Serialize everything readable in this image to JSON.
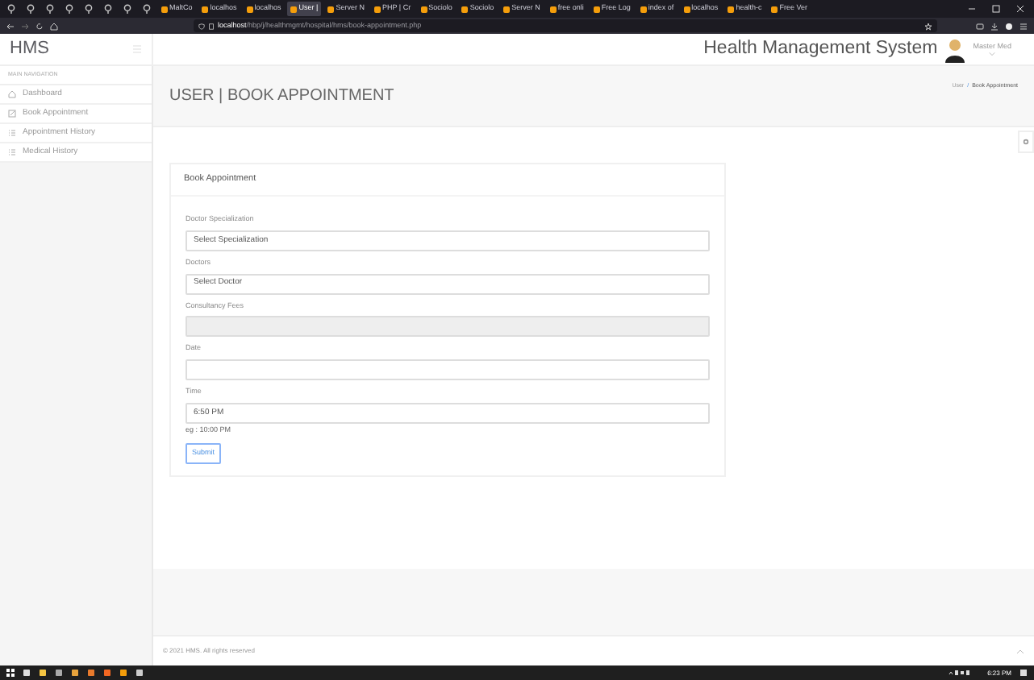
{
  "browser": {
    "tabs": [
      {
        "label": "MaltCo",
        "selected": false
      },
      {
        "label": "localhos",
        "selected": false
      },
      {
        "label": "localhos",
        "selected": false
      },
      {
        "label": "User |",
        "selected": true
      },
      {
        "label": "Server N",
        "selected": false
      },
      {
        "label": "PHP | Cr",
        "selected": false
      },
      {
        "label": "Sociolo",
        "selected": false
      },
      {
        "label": "Sociolo",
        "selected": false
      },
      {
        "label": "Server N",
        "selected": false
      },
      {
        "label": "free onli",
        "selected": false
      },
      {
        "label": "Free Log",
        "selected": false
      },
      {
        "label": "index of",
        "selected": false
      },
      {
        "label": "localhos",
        "selected": false
      },
      {
        "label": "health-c",
        "selected": false
      },
      {
        "label": "Free Ver",
        "selected": false
      }
    ],
    "url_host": "localhost",
    "url_path": "/hbp/j/healthmgmt/hospital/hms/book-appointment.php"
  },
  "header": {
    "logo": "HMS",
    "title": "Health Management System",
    "user": "Master Med"
  },
  "sidebar": {
    "heading": "MAIN NAVIGATION",
    "items": [
      {
        "label": "Dashboard",
        "kind": "home"
      },
      {
        "label": "Book Appointment",
        "kind": "edit"
      },
      {
        "label": "Appointment History",
        "kind": "list"
      },
      {
        "label": "Medical History",
        "kind": "list"
      }
    ]
  },
  "page": {
    "title": "USER | BOOK APPOINTMENT",
    "breadcrumb": [
      "User",
      "Book Appointment"
    ],
    "breadcrumb_separator": "/"
  },
  "form": {
    "title": "Book Appointment",
    "fields": [
      {
        "label": "Doctor Specialization",
        "value": "Select Specialization",
        "disabled": false
      },
      {
        "label": "Doctors",
        "value": "Select Doctor",
        "disabled": false
      },
      {
        "label": "Consultancy Fees",
        "disabled": true
      },
      {
        "label": "Date",
        "disabled": false
      },
      {
        "label": "Time",
        "value": "6:50 PM",
        "disabled": false,
        "hint": "eg : 10:00 PM"
      }
    ],
    "submit": "Submit"
  },
  "footer": {
    "text": "© 2021 HMS. All rights reserved"
  },
  "taskbar": {
    "time": "6:23 PM"
  }
}
